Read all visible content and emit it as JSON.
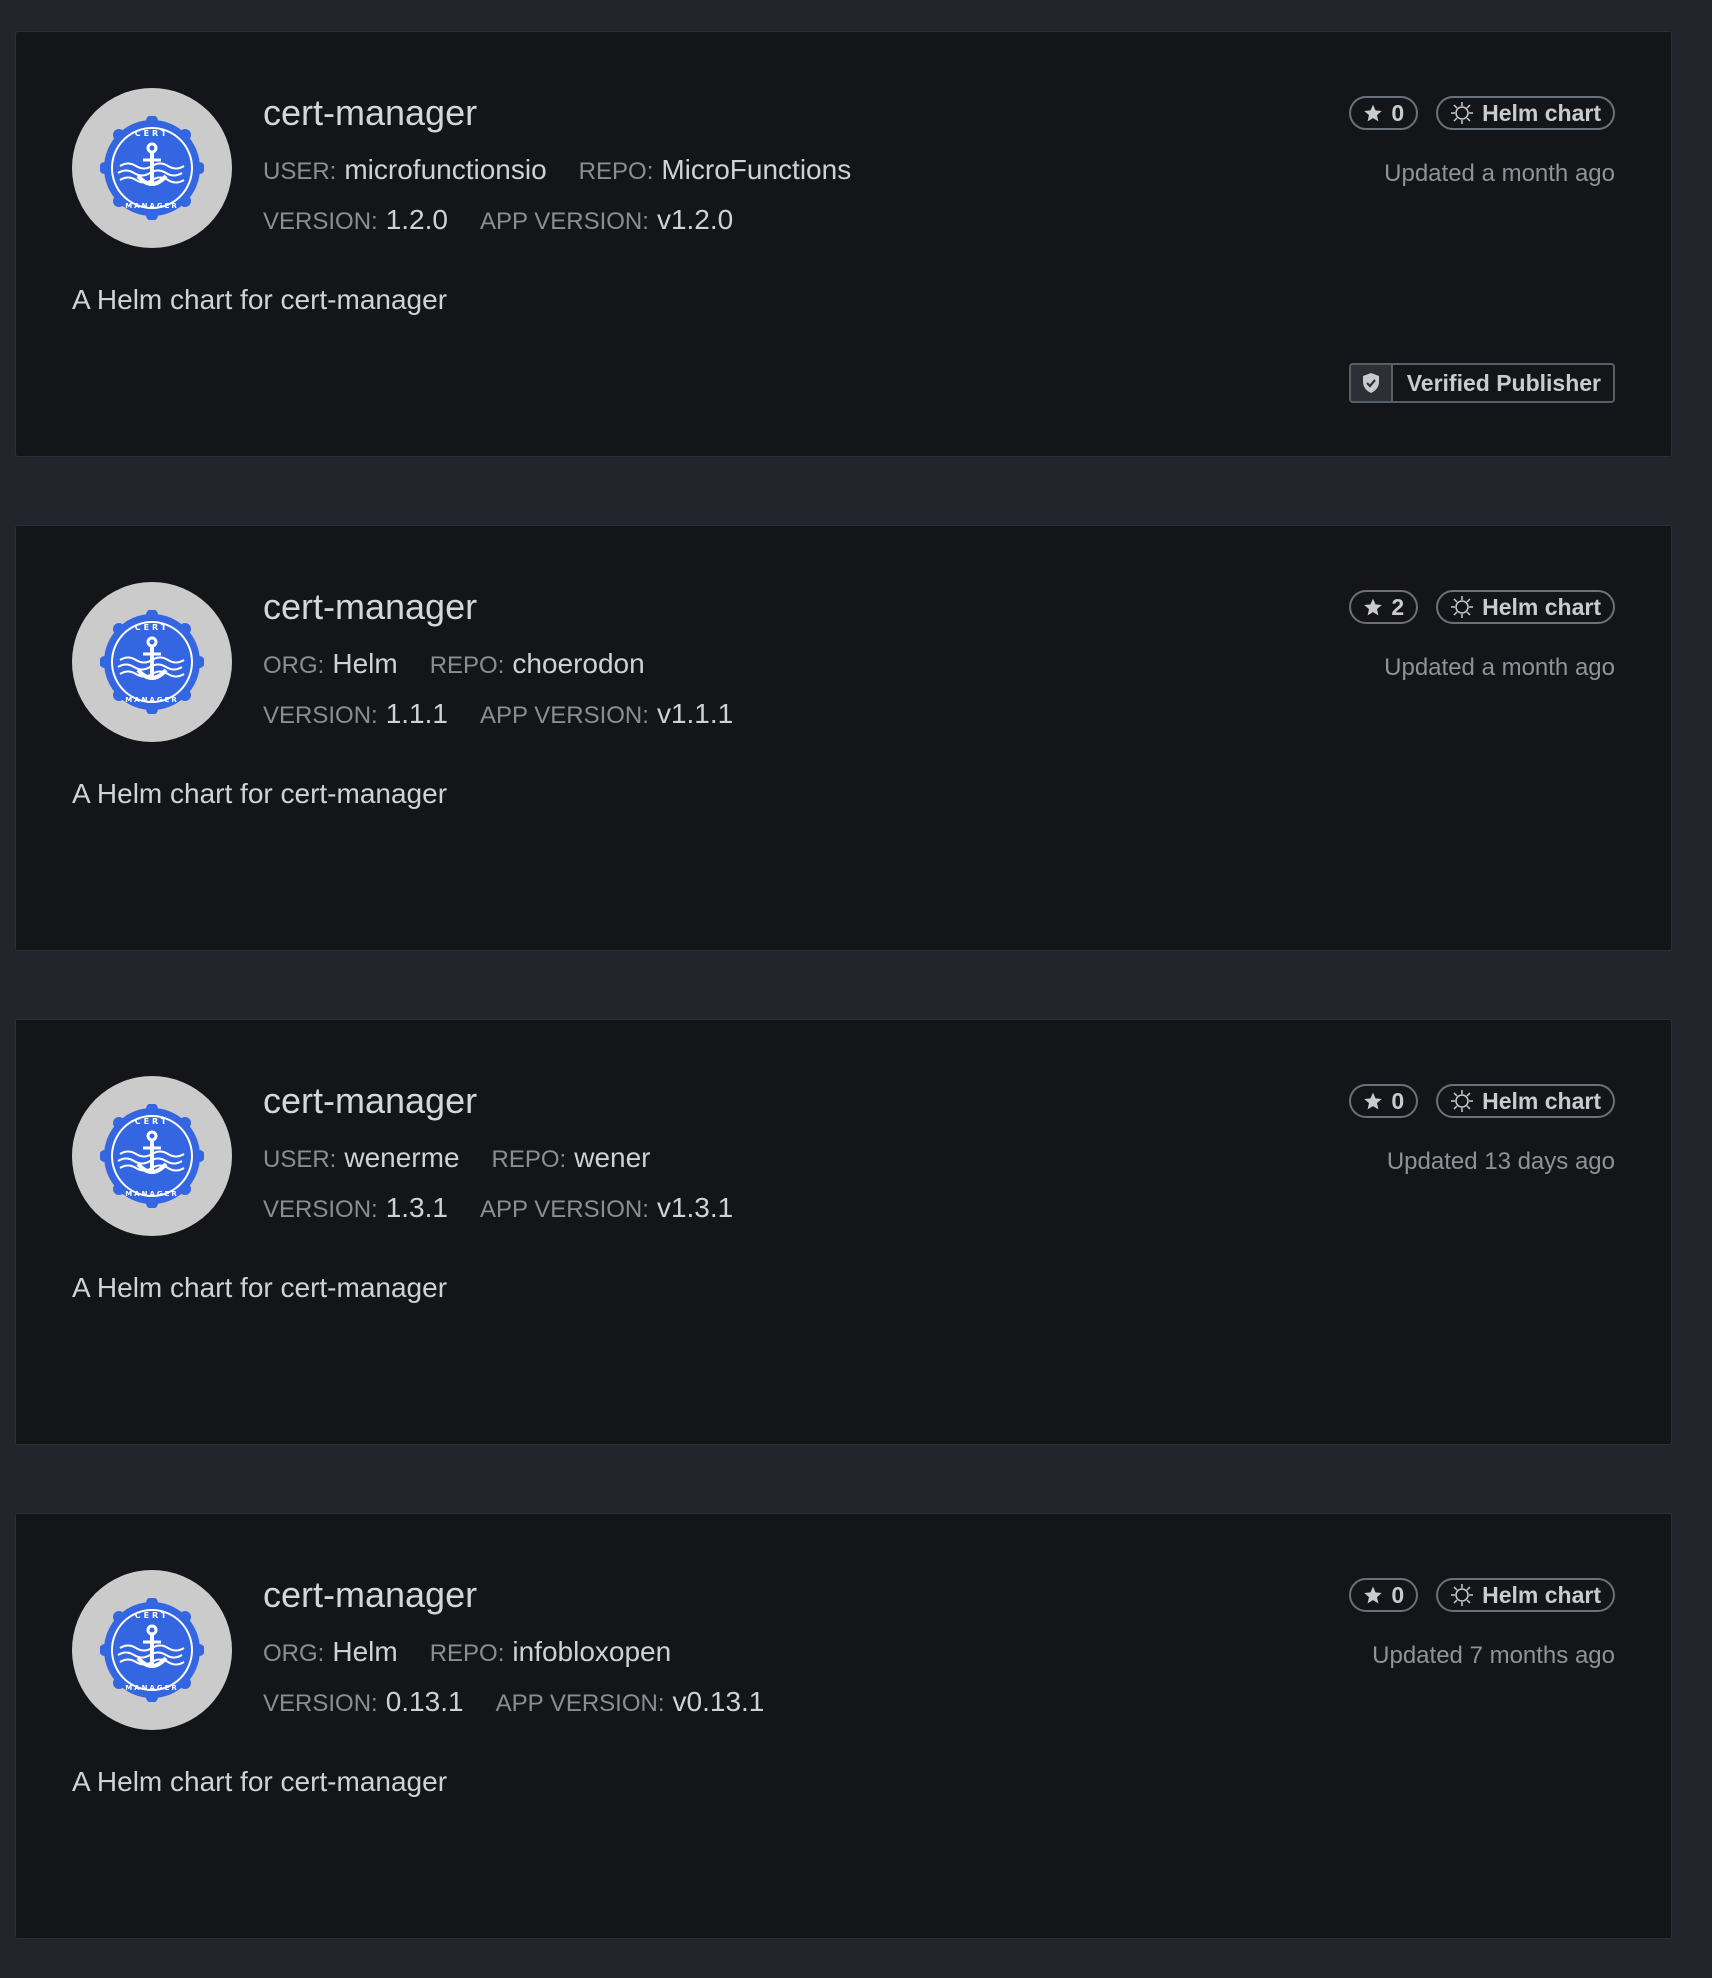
{
  "cards": [
    {
      "title": "cert-manager",
      "owner_label": "USER:",
      "owner": "microfunctionsio",
      "repo_label": "REPO:",
      "repo": "MicroFunctions",
      "version_label": "VERSION:",
      "version": "1.2.0",
      "app_version_label": "APP VERSION:",
      "app_version": "v1.2.0",
      "stars": "0",
      "kind": "Helm chart",
      "updated": "Updated a month ago",
      "description": "A Helm chart for cert-manager",
      "verified": "Verified Publisher"
    },
    {
      "title": "cert-manager",
      "owner_label": "ORG:",
      "owner": "Helm",
      "repo_label": "REPO:",
      "repo": "choerodon",
      "version_label": "VERSION:",
      "version": "1.1.1",
      "app_version_label": "APP VERSION:",
      "app_version": "v1.1.1",
      "stars": "2",
      "kind": "Helm chart",
      "updated": "Updated a month ago",
      "description": "A Helm chart for cert-manager"
    },
    {
      "title": "cert-manager",
      "owner_label": "USER:",
      "owner": "wenerme",
      "repo_label": "REPO:",
      "repo": "wener",
      "version_label": "VERSION:",
      "version": "1.3.1",
      "app_version_label": "APP VERSION:",
      "app_version": "v1.3.1",
      "stars": "0",
      "kind": "Helm chart",
      "updated": "Updated 13 days ago",
      "description": "A Helm chart for cert-manager"
    },
    {
      "title": "cert-manager",
      "owner_label": "ORG:",
      "owner": "Helm",
      "repo_label": "REPO:",
      "repo": "infobloxopen",
      "version_label": "VERSION:",
      "version": "0.13.1",
      "app_version_label": "APP VERSION:",
      "app_version": "v0.13.1",
      "stars": "0",
      "kind": "Helm chart",
      "updated": "Updated 7 months ago",
      "description": "A Helm chart for cert-manager"
    }
  ],
  "icons": {
    "logo": "cert-manager-logo",
    "star": "star-icon",
    "helm": "helm-icon",
    "shield": "shield-check-icon"
  },
  "colors": {
    "page_bg": "#22252b",
    "card_bg": "#141519",
    "logo_blue": "#3366e0",
    "logo_ring": "#cbcbcb"
  }
}
